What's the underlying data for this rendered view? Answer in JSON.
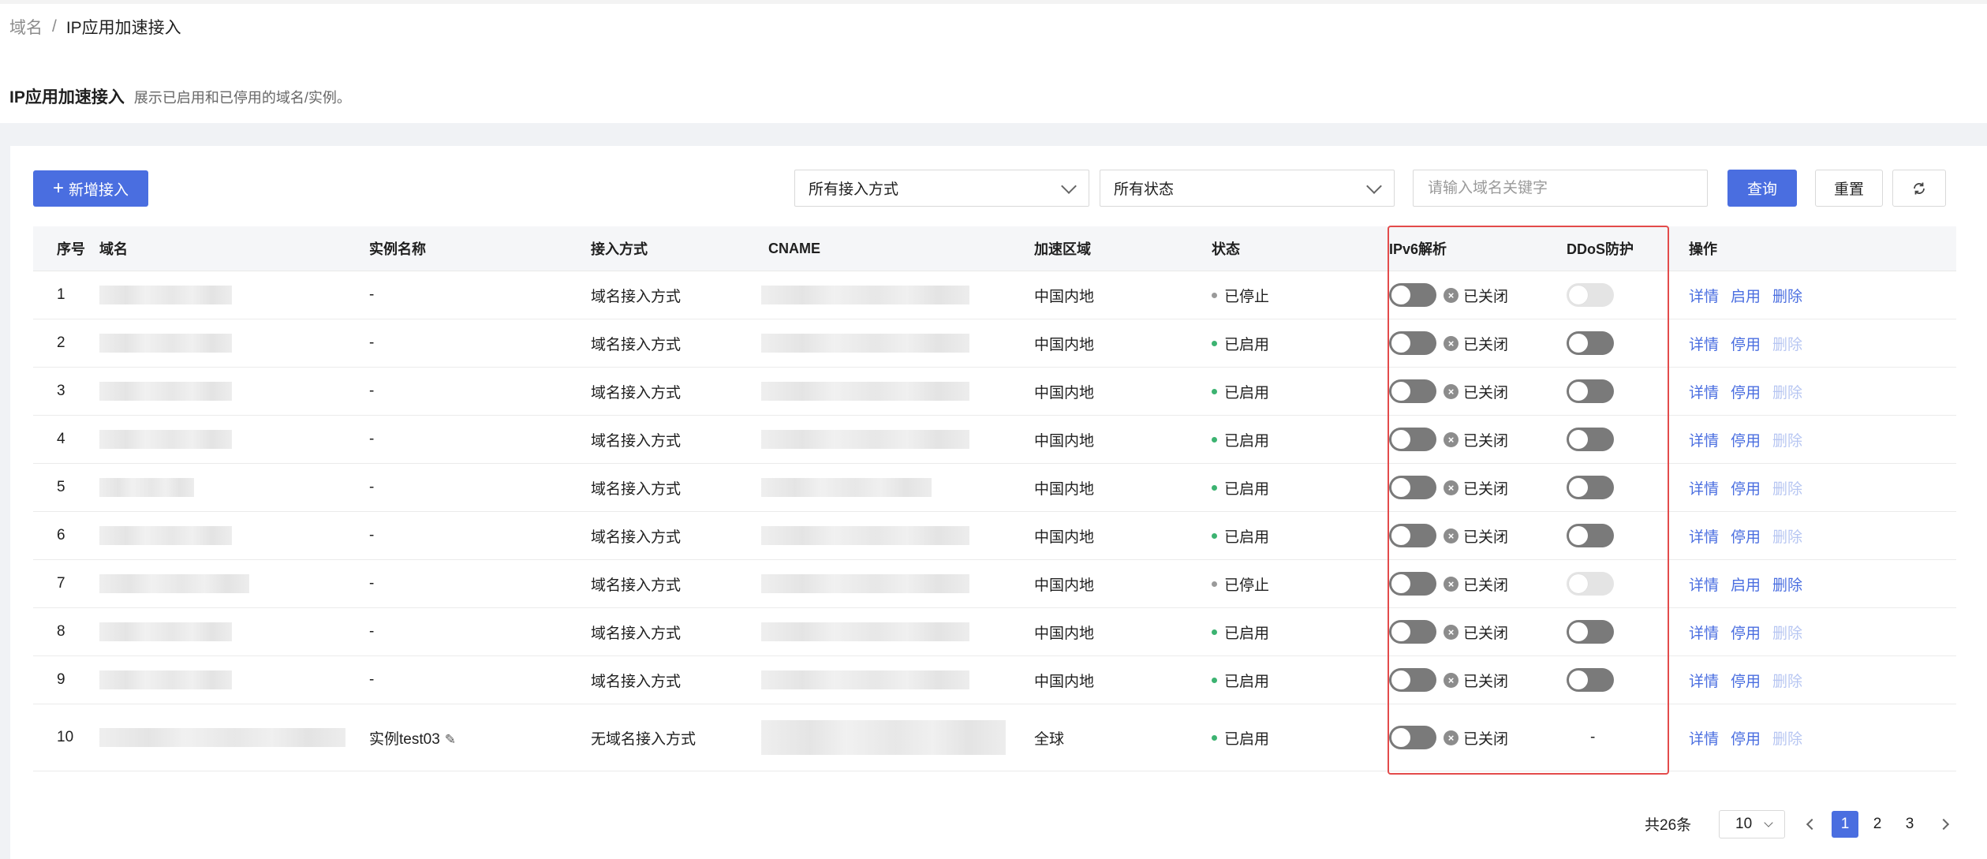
{
  "breadcrumb": {
    "root": "域名",
    "separator": "/",
    "current": "IP应用加速接入"
  },
  "page": {
    "title": "IP应用加速接入",
    "description": "展示已启用和已停用的域名/实例。"
  },
  "toolbar": {
    "add_label": "新增接入",
    "access_method_select": "所有接入方式",
    "status_select": "所有状态",
    "search_placeholder": "请输入域名关键字",
    "query_label": "查询",
    "reset_label": "重置"
  },
  "table": {
    "headers": {
      "index": "序号",
      "domain": "域名",
      "instance": "实例名称",
      "access": "接入方式",
      "cname": "CNAME",
      "region": "加速区域",
      "status": "状态",
      "ipv6": "IPv6解析",
      "ddos": "DDoS防护",
      "actions": "操作"
    },
    "rows": [
      {
        "index": "1",
        "instance": "-",
        "access": "域名接入方式",
        "region": "中国内地",
        "status": "已停止",
        "ipv6": "已关闭",
        "ddos": "",
        "toggle": "启用",
        "detail": "详情",
        "delete": "删除"
      },
      {
        "index": "2",
        "instance": "-",
        "access": "域名接入方式",
        "region": "中国内地",
        "status": "已启用",
        "ipv6": "已关闭",
        "ddos": "",
        "toggle": "停用",
        "detail": "详情",
        "delete": "删除"
      },
      {
        "index": "3",
        "instance": "-",
        "access": "域名接入方式",
        "region": "中国内地",
        "status": "已启用",
        "ipv6": "已关闭",
        "ddos": "",
        "toggle": "停用",
        "detail": "详情",
        "delete": "删除"
      },
      {
        "index": "4",
        "instance": "-",
        "access": "域名接入方式",
        "region": "中国内地",
        "status": "已启用",
        "ipv6": "已关闭",
        "ddos": "",
        "toggle": "停用",
        "detail": "详情",
        "delete": "删除"
      },
      {
        "index": "5",
        "instance": "-",
        "access": "域名接入方式",
        "region": "中国内地",
        "status": "已启用",
        "ipv6": "已关闭",
        "ddos": "",
        "toggle": "停用",
        "detail": "详情",
        "delete": "删除"
      },
      {
        "index": "6",
        "instance": "-",
        "access": "域名接入方式",
        "region": "中国内地",
        "status": "已启用",
        "ipv6": "已关闭",
        "ddos": "",
        "toggle": "停用",
        "detail": "详情",
        "delete": "删除"
      },
      {
        "index": "7",
        "instance": "-",
        "access": "域名接入方式",
        "region": "中国内地",
        "status": "已停止",
        "ipv6": "已关闭",
        "ddos": "",
        "toggle": "启用",
        "detail": "详情",
        "delete": "删除"
      },
      {
        "index": "8",
        "instance": "-",
        "access": "域名接入方式",
        "region": "中国内地",
        "status": "已启用",
        "ipv6": "已关闭",
        "ddos": "",
        "toggle": "停用",
        "detail": "详情",
        "delete": "删除"
      },
      {
        "index": "9",
        "instance": "-",
        "access": "域名接入方式",
        "region": "中国内地",
        "status": "已启用",
        "ipv6": "已关闭",
        "ddos": "",
        "toggle": "停用",
        "detail": "详情",
        "delete": "删除"
      },
      {
        "index": "10",
        "instance": "实例test03",
        "access": "无域名接入方式",
        "region": "全球",
        "status": "已启用",
        "ipv6": "已关闭",
        "ddos": "-",
        "toggle": "停用",
        "detail": "详情",
        "delete": "删除"
      }
    ]
  },
  "pagination": {
    "total": "共26条",
    "page_size": "10",
    "pages": [
      "1",
      "2",
      "3"
    ],
    "current": "1"
  },
  "colors": {
    "primary": "#4a6ee0",
    "highlight": "#e34b4b",
    "enabled": "#3cb371",
    "stopped": "#9a9a9a"
  }
}
